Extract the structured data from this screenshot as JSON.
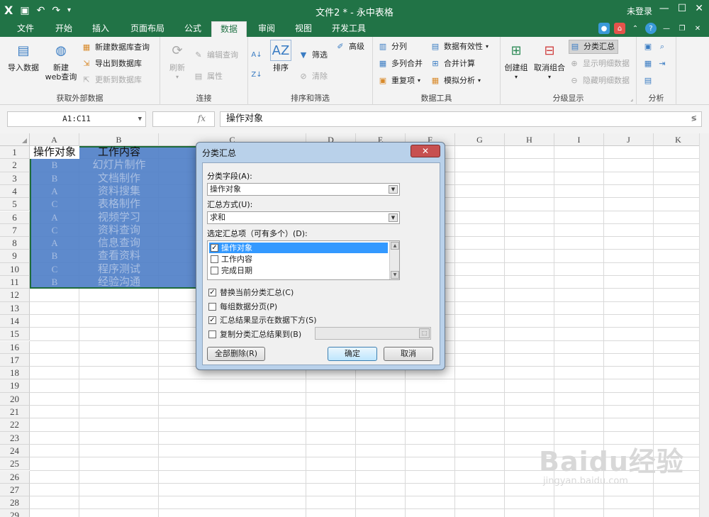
{
  "titlebar": {
    "title": "文件2 * - 永中表格",
    "login": "未登录",
    "qa_icons": [
      "app-logo-icon",
      "save-icon",
      "undo-icon",
      "redo-icon",
      "customize-icon"
    ],
    "logo_text": "X"
  },
  "menu": {
    "tabs": [
      "文件",
      "开始",
      "插入",
      "页面布局",
      "公式",
      "数据",
      "审阅",
      "视图",
      "开发工具"
    ],
    "active": "数据"
  },
  "ribbon": {
    "get_external": {
      "label": "获取外部数据",
      "import": "导入数据",
      "new_web_line1": "新建",
      "new_web_line2": "web查询",
      "new_db_query": "新建数据库查询",
      "export_db": "导出到数据库",
      "update_db": "更新到数据库"
    },
    "connect": {
      "label": "连接",
      "refresh": "刷新",
      "edit_query": "编辑查询",
      "properties": "属性"
    },
    "sort_filter": {
      "label": "排序和筛选",
      "sort": "排序",
      "filter": "筛选",
      "advanced": "高级",
      "clear": "清除"
    },
    "tools": {
      "label": "数据工具",
      "split": "分列",
      "multi_merge": "多列合并",
      "duplicates": "重复项",
      "validation": "数据有效性",
      "consolidate": "合并计算",
      "what_if": "模拟分析"
    },
    "outline": {
      "label": "分级显示",
      "group": "创建组",
      "ungroup": "取消组合",
      "subtotal": "分类汇总",
      "show_detail": "显示明细数据",
      "hide_detail": "隐藏明细数据"
    },
    "analysis": {
      "label": "分析"
    }
  },
  "formula_bar": {
    "name_box": "A1:C11",
    "fx": "fx",
    "content": "操作对象"
  },
  "sheet": {
    "columns": [
      "A",
      "B",
      "C",
      "D",
      "E",
      "F",
      "G",
      "H",
      "I",
      "J",
      "K"
    ],
    "rows": [
      "1",
      "2",
      "3",
      "4",
      "5",
      "6",
      "7",
      "8",
      "9",
      "10",
      "11",
      "12",
      "13",
      "14",
      "15",
      "16",
      "17",
      "18",
      "19",
      "20",
      "21",
      "22",
      "23",
      "24",
      "25",
      "26",
      "27",
      "28",
      "29"
    ],
    "header_row": [
      "操作对象",
      "工作内容"
    ],
    "data": [
      [
        "B",
        "幻灯片制作"
      ],
      [
        "B",
        "文档制作"
      ],
      [
        "A",
        "资料搜集"
      ],
      [
        "C",
        "表格制作"
      ],
      [
        "A",
        "视频学习"
      ],
      [
        "C",
        "资料查询"
      ],
      [
        "A",
        "信息查询"
      ],
      [
        "B",
        "查看资料"
      ],
      [
        "C",
        "程序测试"
      ],
      [
        "B",
        "经验沟通"
      ]
    ]
  },
  "dialog": {
    "title": "分类汇总",
    "close": "✕",
    "field_label": "分类字段(A):",
    "field_value": "操作对象",
    "method_label": "汇总方式(U):",
    "method_value": "求和",
    "items_label": "选定汇总项（可有多个）(D):",
    "items": [
      {
        "label": "操作对象",
        "checked": "✓"
      },
      {
        "label": "工作内容",
        "checked": ""
      },
      {
        "label": "完成日期",
        "checked": ""
      }
    ],
    "opt_replace": "替换当前分类汇总(C)",
    "opt_pagebreak": "每组数据分页(P)",
    "opt_below": "汇总结果显示在数据下方(S)",
    "opt_copy": "复制分类汇总结果到(B)",
    "check_on": "✓",
    "btn_remove_all": "全部删除(R)",
    "btn_ok": "确定",
    "btn_cancel": "取消"
  },
  "watermark": {
    "line1": "Baidu经验",
    "line2": "jingyan.baidu.com"
  }
}
